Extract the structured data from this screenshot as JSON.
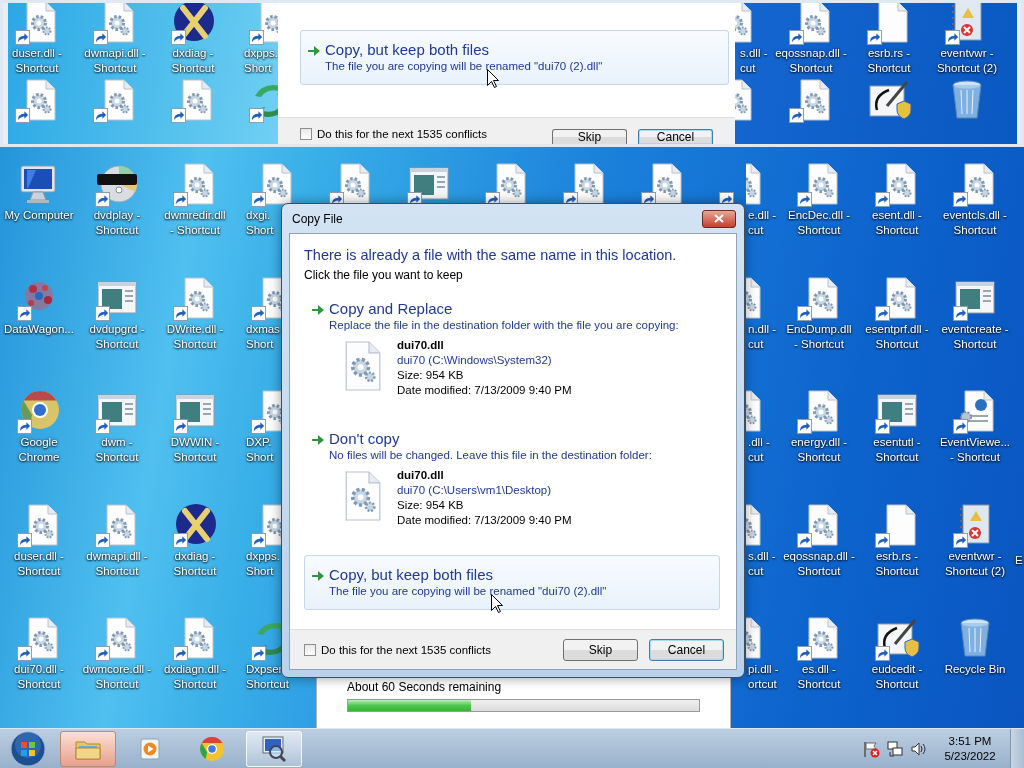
{
  "magnifier": {
    "left_desktop": {
      "columns": [
        {
          "icons": [
            {
              "kind": "gear-file",
              "shortcut": true,
              "label": [
                "duser.dll -",
                "Shortcut"
              ]
            },
            {
              "kind": "gear-file",
              "shortcut": true
            }
          ]
        },
        {
          "icons": [
            {
              "kind": "gear-file",
              "shortcut": true,
              "label": [
                "dwmapi.dll -",
                "Shortcut"
              ]
            },
            {
              "kind": "gear-file",
              "shortcut": true
            }
          ]
        },
        {
          "icons": [
            {
              "kind": "x-ball",
              "shortcut": true,
              "label": [
                "dxdiag -",
                "Shortcut"
              ]
            },
            {
              "kind": "gear-file",
              "shortcut": true
            }
          ]
        },
        {
          "icons": [
            {
              "kind": "gear-file",
              "shortcut": true,
              "label": [
                "dxpps.",
                "Short"
              ]
            },
            {
              "kind": "curved-arrows",
              "shortcut": true
            }
          ]
        }
      ]
    },
    "dialog": {
      "option": {
        "title": "Copy, but keep both files",
        "description": "The file you are copying will be renamed \"dui70 (2).dll\"",
        "hovered": true
      },
      "apply_all": {
        "label": "Do this for the next 1535 conflicts",
        "checked": false
      },
      "buttons": [
        {
          "label": "Skip",
          "default": false
        },
        {
          "label": "Cancel",
          "default": true
        }
      ]
    },
    "right_desktop": {
      "columns": [
        {
          "icons": [
            {
              "kind": "gear-file",
              "shortcut": false,
              "label": [
                "s.dll -",
                "cut"
              ]
            },
            {
              "kind": "gear-file",
              "shortcut": false
            }
          ]
        },
        {
          "icons": [
            {
              "kind": "gear-file",
              "shortcut": true,
              "label": [
                "eqossnap.dll -",
                "Shortcut"
              ]
            },
            {
              "kind": "gear-file",
              "shortcut": true
            }
          ]
        },
        {
          "icons": [
            {
              "kind": "blank-file",
              "shortcut": true,
              "label": [
                "esrb.rs -",
                "Shortcut"
              ]
            },
            {
              "kind": "pen-shield",
              "shortcut": false
            }
          ]
        },
        {
          "icons": [
            {
              "kind": "notebook-warning",
              "shortcut": true,
              "label": [
                "eventvwr -",
                "Shortcut (2)"
              ]
            },
            {
              "kind": "recycle-bin",
              "shortcut": false
            }
          ]
        }
      ]
    }
  },
  "desktop": {
    "left_columns": [
      {
        "icons": [
          {
            "kind": "monitor",
            "shortcut": false,
            "label": [
              "My Computer"
            ]
          },
          {
            "kind": "dots",
            "shortcut": true,
            "label": [
              "DataWagon..."
            ]
          },
          {
            "kind": "browser",
            "shortcut": true,
            "label": [
              "Google",
              "Chrome"
            ]
          },
          {
            "kind": "gear-file",
            "shortcut": true,
            "label": [
              "duser.dll -",
              "Shortcut"
            ]
          },
          {
            "kind": "gear-file",
            "shortcut": true,
            "label": [
              "dui70.dll -",
              "Shortcut"
            ]
          }
        ]
      },
      {
        "icons": [
          {
            "kind": "disc",
            "shortcut": true,
            "label": [
              "dvdplay -",
              "Shortcut"
            ]
          },
          {
            "kind": "window",
            "shortcut": true,
            "label": [
              "dvdupgrd -",
              "Shortcut"
            ]
          },
          {
            "kind": "window",
            "shortcut": true,
            "label": [
              "dwm -",
              "Shortcut"
            ]
          },
          {
            "kind": "gear-file",
            "shortcut": true,
            "label": [
              "dwmapi.dll -",
              "Shortcut"
            ]
          },
          {
            "kind": "gear-file",
            "shortcut": true,
            "label": [
              "dwmcore.dll -",
              "Shortcut"
            ]
          }
        ]
      },
      {
        "icons": [
          {
            "kind": "gear-file",
            "shortcut": true,
            "label": [
              "dwmredir.dll",
              "- Shortcut"
            ]
          },
          {
            "kind": "gear-file",
            "shortcut": true,
            "label": [
              "DWrite.dll -",
              "Shortcut"
            ]
          },
          {
            "kind": "window",
            "shortcut": true,
            "label": [
              "DWWIN -",
              "Shortcut"
            ]
          },
          {
            "kind": "x-ball",
            "shortcut": true,
            "label": [
              "dxdiag -",
              "Shortcut"
            ]
          },
          {
            "kind": "gear-file",
            "shortcut": true,
            "label": [
              "dxdiagn.dll -",
              "Shortcut"
            ]
          }
        ]
      },
      {
        "icons": [
          {
            "kind": "gear-file",
            "shortcut": true,
            "label": [
              "dxgi.",
              "Short"
            ]
          },
          {
            "kind": "gear-file",
            "shortcut": true,
            "label": [
              "dxmas",
              "Short"
            ]
          },
          {
            "kind": "gear-file",
            "shortcut": true,
            "label": [
              "DXP.",
              "Short"
            ]
          },
          {
            "kind": "gear-file",
            "shortcut": true,
            "label": [
              "dxpps.",
              "Short"
            ]
          },
          {
            "kind": "curved-arrows",
            "shortcut": true,
            "label": [
              "Dxpser",
              "Shortcut"
            ]
          }
        ]
      }
    ],
    "middle_columns": [
      {
        "icons": [
          {
            "kind": "gear-file",
            "shortcut": true
          }
        ]
      },
      {
        "icons": [
          {
            "kind": "window",
            "shortcut": true
          }
        ]
      },
      {
        "icons": [
          {
            "kind": "gear-file",
            "shortcut": true
          }
        ]
      },
      {
        "icons": [
          {
            "kind": "gear-file",
            "shortcut": true
          }
        ]
      },
      {
        "icons": [
          {
            "kind": "gear-file",
            "shortcut": true
          }
        ]
      }
    ],
    "right_columns": [
      {
        "icons": [
          {
            "kind": "gear-file",
            "shortcut": true,
            "label": [
              "e.dll -",
              "cut"
            ]
          },
          {
            "kind": "gear-file",
            "shortcut": false,
            "label": [
              "n.dll -",
              "cut"
            ]
          },
          {
            "kind": "gear-file",
            "shortcut": false,
            "label": [
              ".dll -",
              "cut"
            ]
          },
          {
            "kind": "gear-file",
            "shortcut": false,
            "label": [
              "s.dll -",
              "cut"
            ]
          },
          {
            "kind": "gear-file",
            "shortcut": false,
            "label": [
              "pi.dll -",
              "ortcut"
            ]
          }
        ]
      },
      {
        "icons": [
          {
            "kind": "gear-file",
            "shortcut": true,
            "label": [
              "EncDec.dll -",
              "Shortcut"
            ]
          },
          {
            "kind": "gear-file",
            "shortcut": true,
            "label": [
              "EncDump.dll",
              "- Shortcut"
            ]
          },
          {
            "kind": "gear-file",
            "shortcut": true,
            "label": [
              "energy.dll -",
              "Shortcut"
            ]
          },
          {
            "kind": "gear-file",
            "shortcut": true,
            "label": [
              "eqossnap.dll -",
              "Shortcut"
            ]
          },
          {
            "kind": "gear-file",
            "shortcut": true,
            "label": [
              "es.dll -",
              "Shortcut"
            ]
          }
        ]
      },
      {
        "icons": [
          {
            "kind": "gear-file",
            "shortcut": true,
            "label": [
              "esent.dll -",
              "Shortcut"
            ]
          },
          {
            "kind": "gear-file",
            "shortcut": true,
            "label": [
              "esentprf.dll -",
              "Shortcut"
            ]
          },
          {
            "kind": "window",
            "shortcut": true,
            "label": [
              "esentutl -",
              "Shortcut"
            ]
          },
          {
            "kind": "blank-file",
            "shortcut": true,
            "label": [
              "esrb.rs -",
              "Shortcut"
            ]
          },
          {
            "kind": "pen-shield",
            "shortcut": true,
            "label": [
              "eudcedit -",
              "Shortcut"
            ]
          }
        ]
      },
      {
        "icons": [
          {
            "kind": "gear-file",
            "shortcut": true,
            "label": [
              "eventcls.dll -",
              "Shortcut"
            ]
          },
          {
            "kind": "window",
            "shortcut": true,
            "label": [
              "eventcreate -",
              "Shortcut"
            ]
          },
          {
            "kind": "document-globe",
            "shortcut": true,
            "label": [
              "EventViewe...",
              "- Shortcut"
            ]
          },
          {
            "kind": "notebook-warning",
            "shortcut": true,
            "label": [
              "eventvwr -",
              "Shortcut (2)"
            ]
          },
          {
            "kind": "recycle-bin",
            "shortcut": false,
            "label": [
              "Recycle Bin"
            ]
          }
        ]
      }
    ],
    "edge_labels": [
      "E"
    ]
  },
  "progress_window": {
    "status": "About 60 Seconds remaining",
    "level": 0.35
  },
  "dialog": {
    "title": "Copy File",
    "heading": "There is already a file with the same name in this location.",
    "instruction": "Click the file you want to keep",
    "options": [
      {
        "title": "Copy and Replace",
        "description": "Replace the file in the destination folder with the file you are copying:",
        "hovered": false,
        "file": {
          "name": "dui70.dll",
          "location": "dui70 (C:\\Windows\\System32)",
          "size": "Size: 954 KB",
          "modified": "Date modified: 7/13/2009 9:40 PM"
        }
      },
      {
        "title": "Don't copy",
        "description": "No files will be changed. Leave this file in the destination folder:",
        "hovered": false,
        "file": {
          "name": "dui70.dll",
          "location": "dui70 (C:\\Users\\vm1\\Desktop)",
          "size": "Size: 954 KB",
          "modified": "Date modified: 7/13/2009 9:40 PM"
        }
      },
      {
        "title": "Copy, but keep both files",
        "description": "The file you are copying will be renamed \"dui70 (2).dll\"",
        "hovered": true
      }
    ],
    "apply_all": {
      "label": "Do this for the next 1535 conflicts",
      "checked": false
    },
    "buttons": [
      {
        "label": "Skip",
        "default": false
      },
      {
        "label": "Cancel",
        "default": true
      }
    ]
  },
  "taskbar": {
    "apps": [
      {
        "kind": "folder",
        "flashing": true,
        "selected": false
      },
      {
        "kind": "media",
        "flashing": false,
        "selected": false
      },
      {
        "kind": "browser",
        "flashing": false,
        "selected": false
      },
      {
        "kind": "magnifier",
        "flashing": false,
        "selected": true
      }
    ],
    "clock": {
      "time": "3:51 PM",
      "date": "5/23/2022"
    }
  }
}
